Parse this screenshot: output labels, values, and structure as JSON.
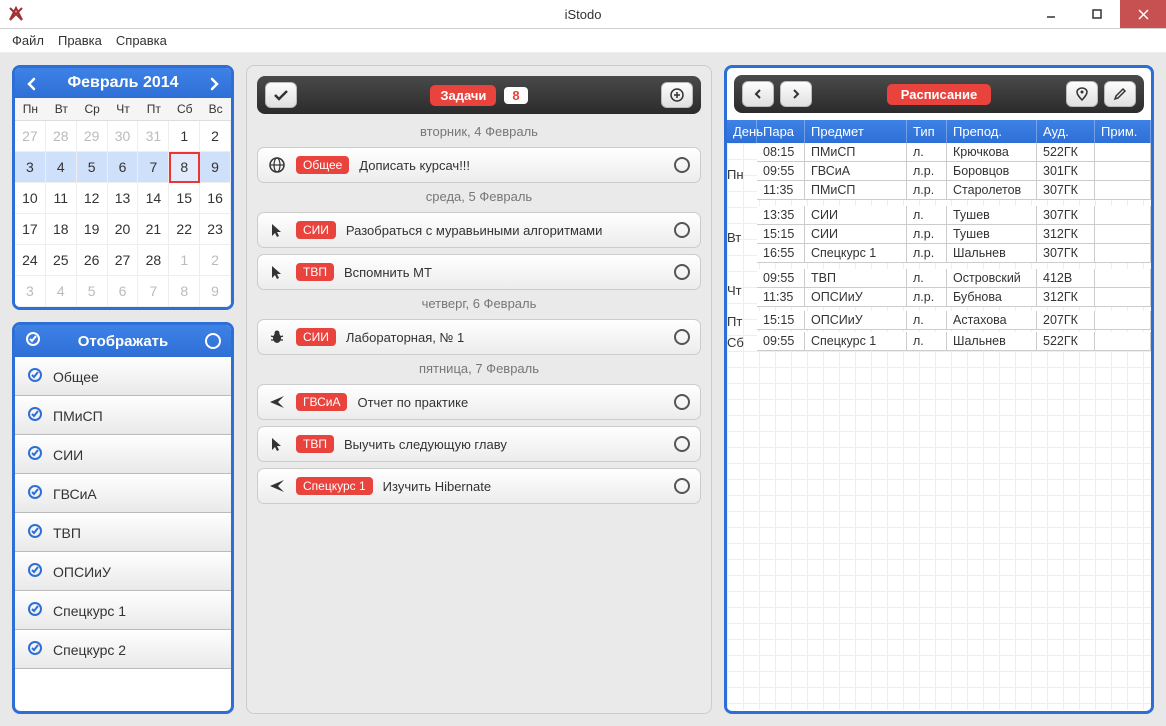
{
  "window": {
    "title": "iStodo"
  },
  "menu": {
    "file": "Файл",
    "edit": "Правка",
    "help": "Справка"
  },
  "calendar": {
    "title": "Февраль 2014",
    "dow": [
      "Пн",
      "Вт",
      "Ср",
      "Чт",
      "Пт",
      "Сб",
      "Вс"
    ],
    "cells": [
      {
        "n": "27",
        "muted": true
      },
      {
        "n": "28",
        "muted": true
      },
      {
        "n": "29",
        "muted": true
      },
      {
        "n": "30",
        "muted": true
      },
      {
        "n": "31",
        "muted": true
      },
      {
        "n": "1"
      },
      {
        "n": "2"
      },
      {
        "n": "3",
        "hl": true
      },
      {
        "n": "4",
        "hl": true
      },
      {
        "n": "5",
        "hl": true
      },
      {
        "n": "6",
        "hl": true
      },
      {
        "n": "7",
        "hl": true
      },
      {
        "n": "8",
        "hl": true,
        "today": true
      },
      {
        "n": "9",
        "hl": true
      },
      {
        "n": "10"
      },
      {
        "n": "11"
      },
      {
        "n": "12"
      },
      {
        "n": "13"
      },
      {
        "n": "14"
      },
      {
        "n": "15"
      },
      {
        "n": "16"
      },
      {
        "n": "17"
      },
      {
        "n": "18"
      },
      {
        "n": "19"
      },
      {
        "n": "20"
      },
      {
        "n": "21"
      },
      {
        "n": "22"
      },
      {
        "n": "23"
      },
      {
        "n": "24"
      },
      {
        "n": "25"
      },
      {
        "n": "26"
      },
      {
        "n": "27"
      },
      {
        "n": "28"
      },
      {
        "n": "1",
        "muted": true
      },
      {
        "n": "2",
        "muted": true
      },
      {
        "n": "3",
        "muted": true
      },
      {
        "n": "4",
        "muted": true
      },
      {
        "n": "5",
        "muted": true
      },
      {
        "n": "6",
        "muted": true
      },
      {
        "n": "7",
        "muted": true
      },
      {
        "n": "8",
        "muted": true
      },
      {
        "n": "9",
        "muted": true
      }
    ]
  },
  "filter": {
    "title": "Отображать",
    "items": [
      "Общее",
      "ПМиСП",
      "СИИ",
      "ГВСиА",
      "ТВП",
      "ОПСИиУ",
      "Спецкурс 1",
      "Спецкурс 2"
    ]
  },
  "tasks": {
    "title": "Задачи",
    "count": "8",
    "days": [
      {
        "label": "вторник, 4 Февраль",
        "items": [
          {
            "icon": "globe",
            "tag": "Общее",
            "text": "Дописать курсач!!!"
          }
        ]
      },
      {
        "label": "среда, 5 Февраль",
        "items": [
          {
            "icon": "cursor",
            "tag": "СИИ",
            "text": "Разобраться с муравьиными алгоритмами"
          },
          {
            "icon": "cursor",
            "tag": "ТВП",
            "text": "Вспомнить МТ"
          }
        ]
      },
      {
        "label": "четверг, 6 Февраль",
        "items": [
          {
            "icon": "bug",
            "tag": "СИИ",
            "text": "Лабораторная,  № 1"
          }
        ]
      },
      {
        "label": "пятница, 7 Февраль",
        "items": [
          {
            "icon": "plane",
            "tag": "ГВСиА",
            "text": "Отчет по практике"
          },
          {
            "icon": "cursor",
            "tag": "ТВП",
            "text": "Выучить следующую главу"
          },
          {
            "icon": "plane",
            "tag": "Спецкурс 1",
            "text": "Изучить Hibernate"
          }
        ]
      }
    ]
  },
  "schedule": {
    "title": "Расписание",
    "cols": {
      "day": "День",
      "time": "Пара",
      "subj": "Предмет",
      "type": "Тип",
      "teach": "Препод.",
      "room": "Ауд.",
      "note": "Прим."
    },
    "rows": [
      {
        "day": "Пн",
        "time": "08:15",
        "subj": "ПМиСП",
        "type": "л.",
        "teach": "Крючкова",
        "room": "522ГК",
        "daystart": true,
        "dayspan": 3
      },
      {
        "day": "",
        "time": "09:55",
        "subj": "ГВСиА",
        "type": "л.р.",
        "teach": "Боровцов",
        "room": "301ГК"
      },
      {
        "day": "",
        "time": "11:35",
        "subj": "ПМиСП",
        "type": "л.р.",
        "teach": "Старолетов",
        "room": "307ГК"
      },
      {
        "day": "Вт",
        "time": "13:35",
        "subj": "СИИ",
        "type": "л.",
        "teach": "Тушев",
        "room": "307ГК",
        "daystart": true,
        "dayspan": 3
      },
      {
        "day": "",
        "time": "15:15",
        "subj": "СИИ",
        "type": "л.р.",
        "teach": "Тушев",
        "room": "312ГК"
      },
      {
        "day": "",
        "time": "16:55",
        "subj": "Спецкурс 1",
        "type": "л.р.",
        "teach": "Шальнев",
        "room": "307ГК"
      },
      {
        "day": "Чт",
        "time": "09:55",
        "subj": "ТВП",
        "type": "л.",
        "teach": "Островский",
        "room": "412В",
        "daystart": true,
        "dayspan": 2
      },
      {
        "day": "",
        "time": "11:35",
        "subj": "ОПСИиУ",
        "type": "л.р.",
        "teach": "Бубнова",
        "room": "312ГК"
      },
      {
        "day": "Пт",
        "time": "15:15",
        "subj": "ОПСИиУ",
        "type": "л.",
        "teach": "Астахова",
        "room": "207ГК",
        "daystart": true,
        "dayspan": 1
      },
      {
        "day": "Сб",
        "time": "09:55",
        "subj": "Спецкурс 1",
        "type": "л.",
        "teach": "Шальнев",
        "room": "522ГК",
        "daystart": true,
        "dayspan": 1
      }
    ]
  }
}
